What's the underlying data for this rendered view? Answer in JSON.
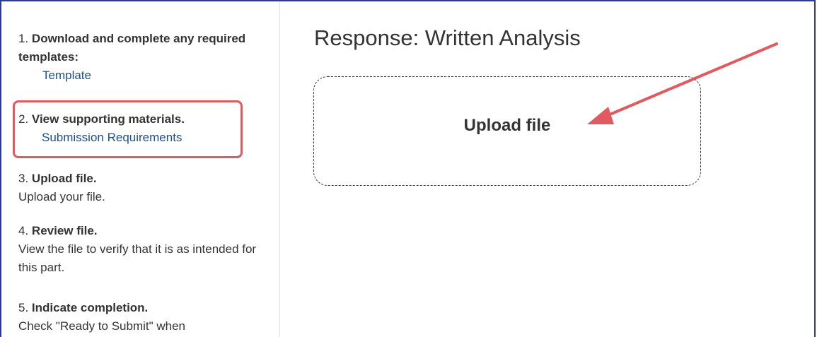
{
  "steps": [
    {
      "number": "1.",
      "title": "Download and complete any required templates:",
      "link": "Template"
    },
    {
      "number": "2.",
      "title": "View supporting materials.",
      "link": "Submission Requirements"
    },
    {
      "number": "3.",
      "title": "Upload file.",
      "description": "Upload your file."
    },
    {
      "number": "4.",
      "title": "Review file.",
      "description": "View the file to verify that it is as intended for this part."
    },
    {
      "number": "5.",
      "title": "Indicate completion.",
      "description": "Check \"Ready to Submit\" when"
    }
  ],
  "main": {
    "title": "Response: Written Analysis",
    "upload_label": "Upload file"
  },
  "colors": {
    "frame_border": "#2e3a8c",
    "link": "#1f4e8c",
    "annotation": "#e05a5f"
  }
}
